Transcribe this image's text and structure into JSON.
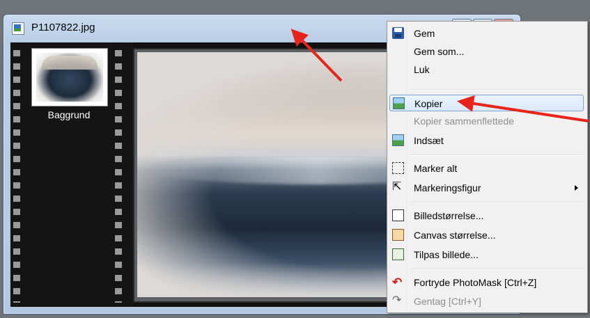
{
  "window": {
    "title": "P1107822.jpg"
  },
  "filmstrip": {
    "layer_name": "Baggrund"
  },
  "context_menu": {
    "items": [
      {
        "label": "Gem",
        "icon": "save-icon"
      },
      {
        "label": "Gem som...",
        "icon": ""
      },
      {
        "label": "Luk",
        "icon": ""
      },
      {
        "label": "Kopier",
        "icon": "copy-image-icon",
        "highlighted": true
      },
      {
        "label": "Kopier sammenflettede",
        "icon": "",
        "disabled": true
      },
      {
        "label": "Indsæt",
        "icon": "paste-image-icon"
      },
      {
        "label": "Marker alt",
        "icon": "select-all-icon"
      },
      {
        "label": "Markeringsfigur",
        "icon": "cursor-icon",
        "submenu": true
      },
      {
        "label": "Billedstørrelse...",
        "icon": "image-size-icon"
      },
      {
        "label": "Canvas størrelse...",
        "icon": "canvas-size-icon"
      },
      {
        "label": "Tilpas billede...",
        "icon": "fit-image-icon"
      },
      {
        "label": "Fortryde PhotoMask [Ctrl+Z]",
        "icon": "undo-icon"
      },
      {
        "label": "Gentag [Ctrl+Y]",
        "icon": "redo-icon",
        "disabled": true
      }
    ]
  },
  "colors": {
    "annotation_arrow": "#e8231a",
    "menu_highlight_border": "#7da2ce"
  }
}
